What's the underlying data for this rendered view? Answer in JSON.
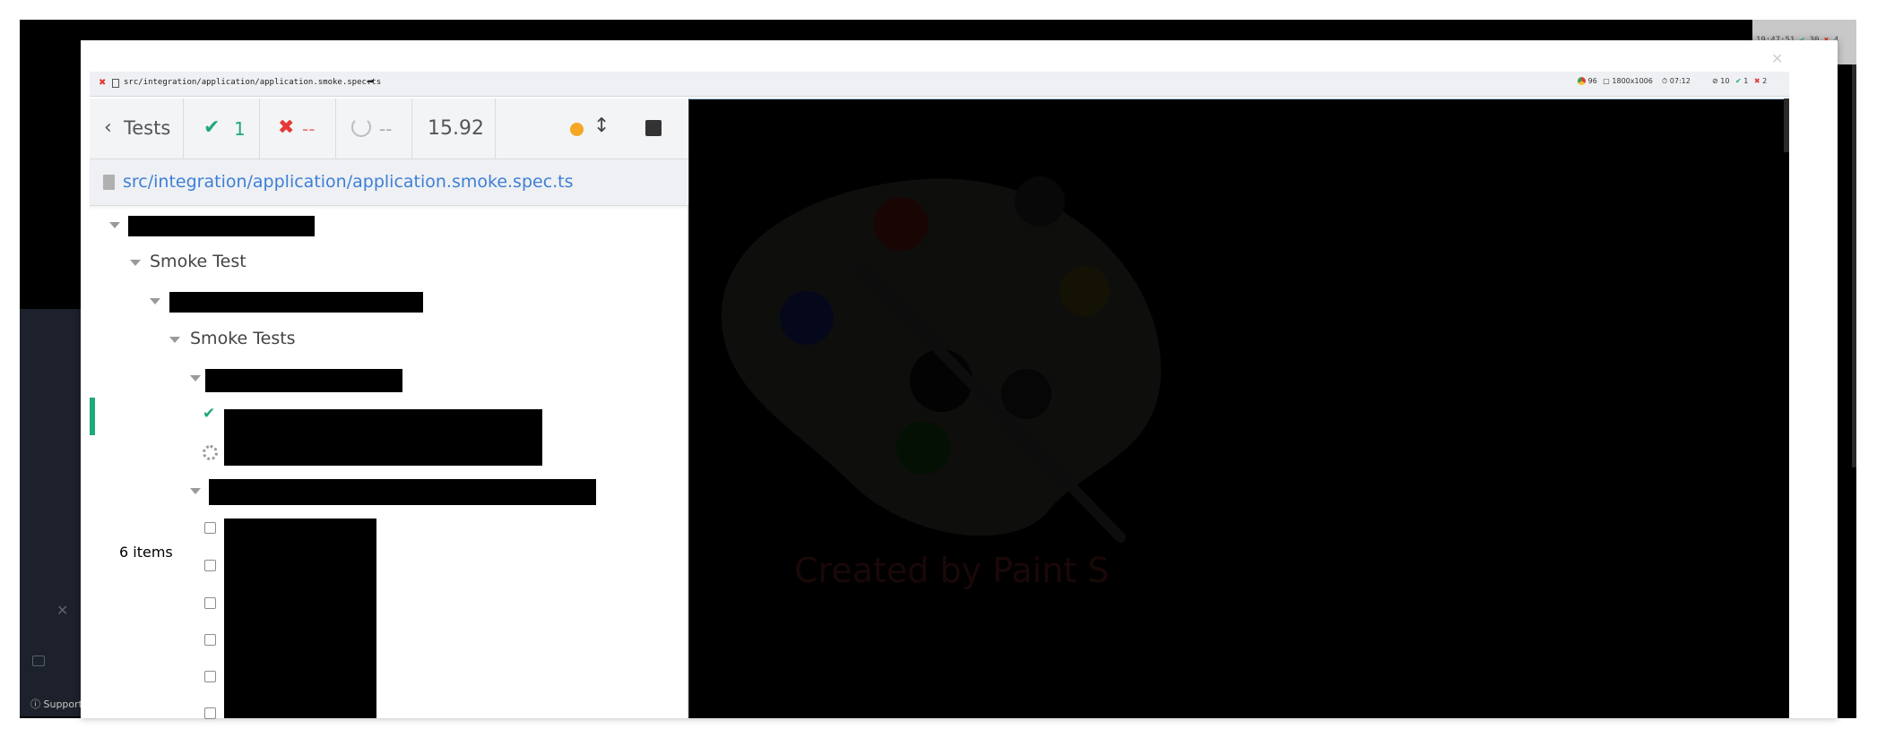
{
  "outer_topbar": {
    "timer": "19:47:51",
    "passed": "30",
    "failed": "4"
  },
  "footer": {
    "support_label": "Support"
  },
  "spec_bar": {
    "path": "src/integration/application/application.smoke.spec.ts",
    "browser_version": "96",
    "viewport": "1800x1006",
    "duration": "07:12",
    "pending": "10",
    "passed": "1",
    "failed": "2"
  },
  "reporter": {
    "back_label": "Tests",
    "passed": "1",
    "failed": "--",
    "pending": "--",
    "duration": "15.92",
    "file_path": "src/integration/application/application.smoke.spec.ts",
    "items_count": "6 items",
    "tree": {
      "suite_2": "Smoke Test",
      "suite_4": "Smoke Tests"
    }
  },
  "preview": {
    "watermark": "Created by Paint S"
  },
  "colors": {
    "pass": "#1fa87a",
    "fail": "#e53935",
    "link": "#3e7fd6",
    "pending_dot": "#f5a623"
  }
}
